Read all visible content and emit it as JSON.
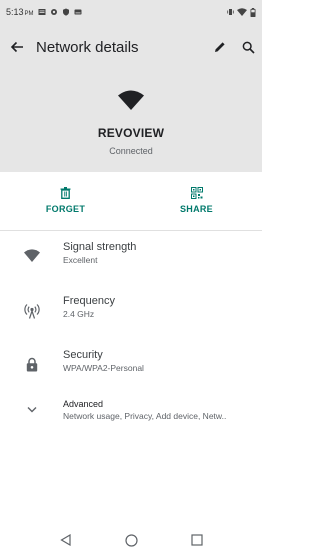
{
  "status_bar": {
    "time": "5:13",
    "ampm": "PM"
  },
  "app_bar": {
    "title": "Network details"
  },
  "network": {
    "ssid": "REVOVIEW",
    "status": "Connected"
  },
  "actions": {
    "forget_label": "FORGET",
    "share_label": "SHARE"
  },
  "details": [
    {
      "title": "Signal strength",
      "value": "Excellent",
      "icon": "wifi-signal-icon"
    },
    {
      "title": "Frequency",
      "value": "2.4 GHz",
      "icon": "frequency-antenna-icon"
    },
    {
      "title": "Security",
      "value": "WPA/WPA2-Personal",
      "icon": "lock-icon"
    },
    {
      "title": "Advanced",
      "value": "Network usage, Privacy, Add device, Netw..",
      "icon": "chevron-down-icon"
    }
  ],
  "colors": {
    "accent": "#00796b",
    "header_bg": "#e6e6e6"
  }
}
